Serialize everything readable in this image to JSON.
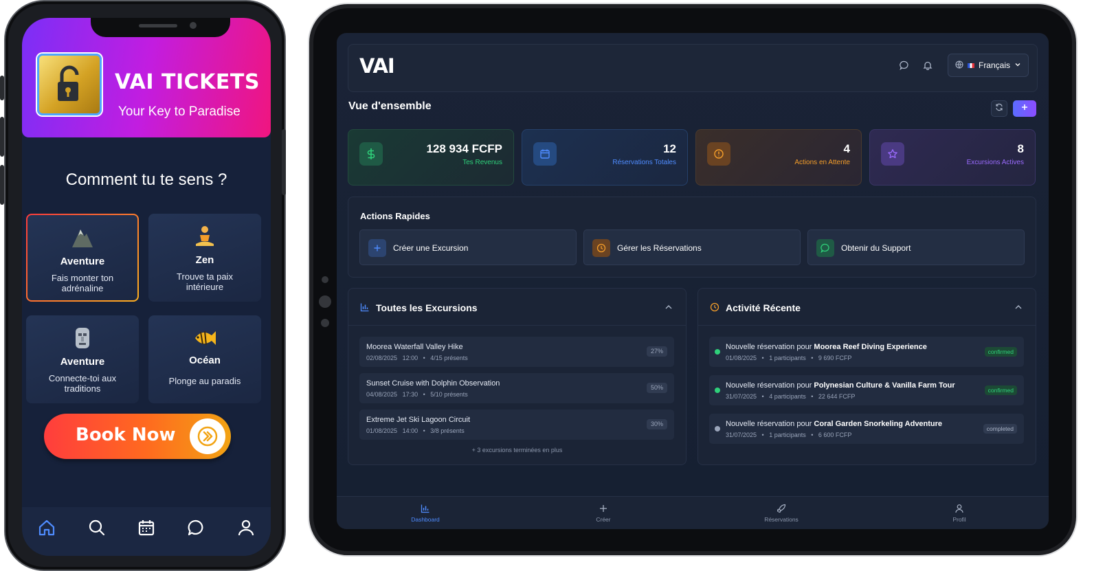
{
  "phone": {
    "brand": {
      "title": "VAI TICKETS",
      "subtitle": "Your Key to Paradise"
    },
    "question": "Comment tu te sens ?",
    "moods": [
      {
        "title": "Aventure",
        "desc": "Fais monter ton adrénaline",
        "icon": "mountain-icon",
        "selected": true
      },
      {
        "title": "Zen",
        "desc": "Trouve ta paix intérieure",
        "icon": "meditation-icon",
        "selected": false
      },
      {
        "title": "Aventure",
        "desc": "Connecte-toi aux traditions",
        "icon": "tiki-icon",
        "selected": false
      },
      {
        "title": "Océan",
        "desc": "Plonge au paradis",
        "icon": "fish-icon",
        "selected": false
      }
    ],
    "book_now": "Book Now",
    "nav": [
      "home-icon",
      "search-icon",
      "calendar-icon",
      "chat-icon",
      "user-icon"
    ],
    "nav_active": "home-icon"
  },
  "tablet": {
    "logo": "VAI",
    "language": "Français",
    "page_title": "Vue d'ensemble",
    "stats": [
      {
        "value": "128 934 FCFP",
        "label": "Tes Revenus",
        "icon": "dollar-icon",
        "color": "#2fd07a"
      },
      {
        "value": "12",
        "label": "Réservations Totales",
        "icon": "calendar-icon",
        "color": "#4f8cff"
      },
      {
        "value": "4",
        "label": "Actions en Attente",
        "icon": "alert-icon",
        "color": "#f59e2a"
      },
      {
        "value": "8",
        "label": "Excursions Actives",
        "icon": "star-icon",
        "color": "#9b6bff"
      }
    ],
    "quick_actions": {
      "title": "Actions Rapides",
      "items": [
        {
          "label": "Créer une Excursion",
          "icon": "plus-icon"
        },
        {
          "label": "Gérer les Réservations",
          "icon": "clock-icon"
        },
        {
          "label": "Obtenir du Support",
          "icon": "chat-icon"
        }
      ]
    },
    "excursions": {
      "title": "Toutes les Excursions",
      "rows": [
        {
          "name": "Moorea Waterfall Valley Hike",
          "date": "02/08/2025",
          "time": "12:00",
          "present": "4/15 présents",
          "pct": "27%"
        },
        {
          "name": "Sunset Cruise with Dolphin Observation",
          "date": "04/08/2025",
          "time": "17:30",
          "present": "5/10 présents",
          "pct": "50%"
        },
        {
          "name": "Extreme Jet Ski Lagoon Circuit",
          "date": "01/08/2025",
          "time": "14:00",
          "present": "3/8 présents",
          "pct": "30%"
        }
      ],
      "more": "+ 3 excursions terminées en plus"
    },
    "activity": {
      "title": "Activité Récente",
      "prefix": "Nouvelle réservation pour",
      "rows": [
        {
          "name": "Moorea Reef Diving Experience",
          "date": "01/08/2025",
          "participants": "1 participants",
          "amount": "9 690 FCFP",
          "status": "confirmed"
        },
        {
          "name": "Polynesian Culture & Vanilla Farm Tour",
          "date": "31/07/2025",
          "participants": "4 participants",
          "amount": "22 644 FCFP",
          "status": "confirmed"
        },
        {
          "name": "Coral Garden Snorkeling Adventure",
          "date": "31/07/2025",
          "participants": "1 participants",
          "amount": "6 600 FCFP",
          "status": "completed"
        }
      ]
    },
    "nav": [
      {
        "label": "Dashboard",
        "icon": "bar-chart-icon",
        "active": true
      },
      {
        "label": "Créer",
        "icon": "plus-icon",
        "active": false
      },
      {
        "label": "Réservations",
        "icon": "rocket-icon",
        "active": false
      },
      {
        "label": "Profil",
        "icon": "user-icon",
        "active": false
      }
    ],
    "colors": {
      "accent": "#4f8cff",
      "success": "#2fd07a",
      "warning": "#f59e2a",
      "purple": "#9b6bff"
    }
  }
}
